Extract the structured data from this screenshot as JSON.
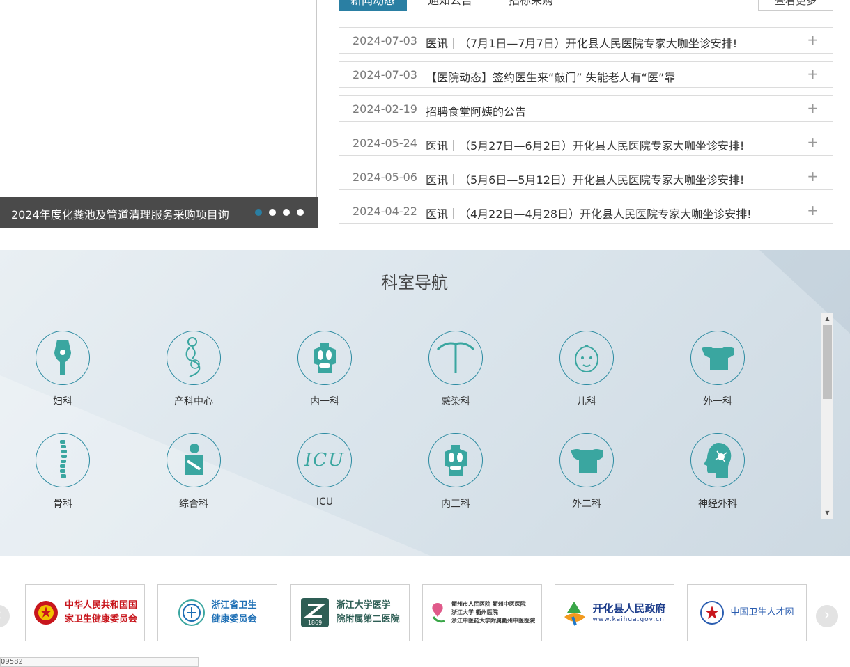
{
  "slider": {
    "caption": "2024年度化粪池及管道清理服务采购项目询",
    "dot_count": 4,
    "active_dot": 1
  },
  "news": {
    "tabs": [
      "新闻动态",
      "通知公告",
      "招标采购"
    ],
    "more": "查看更多",
    "items": [
      {
        "date": "2024-07-03",
        "title": "医讯｜（7月1日—7月7日）开化县人民医院专家大咖坐诊安排!"
      },
      {
        "date": "2024-07-03",
        "title": "【医院动态】签约医生来“敲门” 失能老人有“医”靠"
      },
      {
        "date": "2024-02-19",
        "title": "招聘食堂阿姨的公告"
      },
      {
        "date": "2024-05-24",
        "title": "医讯｜（5月27日—6月2日）开化县人民医院专家大咖坐诊安排!"
      },
      {
        "date": "2024-05-06",
        "title": "医讯｜（5月6日—5月12日）开化县人民医院专家大咖坐诊安排!"
      },
      {
        "date": "2024-04-22",
        "title": "医讯｜（4月22日—4月28日）开化县人民医院专家大咖坐诊安排!"
      }
    ],
    "plus": "+"
  },
  "dept": {
    "title": "科室导航",
    "items": [
      {
        "label": "妇科",
        "icon": "uterus-icon"
      },
      {
        "label": "产科中心",
        "icon": "pregnant-woman-icon"
      },
      {
        "label": "内一科",
        "icon": "torso-organs-icon"
      },
      {
        "label": "感染科",
        "icon": "iud-icon"
      },
      {
        "label": "儿科",
        "icon": "baby-face-icon"
      },
      {
        "label": "外一科",
        "icon": "torso-icon"
      },
      {
        "label": "骨科",
        "icon": "spine-icon"
      },
      {
        "label": "综合科",
        "icon": "patient-arm-sling-icon"
      },
      {
        "label": "ICU",
        "icon": "icu-text-icon",
        "icon_text": "ICU"
      },
      {
        "label": "内三科",
        "icon": "torso-organs-icon"
      },
      {
        "label": "外二科",
        "icon": "torso-icon"
      },
      {
        "label": "神经外科",
        "icon": "brain-head-icon"
      }
    ],
    "accent": "#2a8aa0",
    "icon_color": "#3aa6a0"
  },
  "links": [
    {
      "lines": [
        "中华人民共和国国",
        "家卫生健康委员会"
      ],
      "color": "#c8161d",
      "logo": "national-emblem-icon"
    },
    {
      "lines": [
        "浙江省卫生",
        "健康委员会"
      ],
      "color": "#1e6fb5",
      "logo": "zj-health-logo-icon"
    },
    {
      "lines": [
        "浙江大学医学",
        "院附属第二医院"
      ],
      "color": "#2e5e55",
      "logo": "zju-second-hospital-logo-icon",
      "badge": "1869"
    },
    {
      "lines": [
        "衢州市人民医院 衢州中医医院",
        "浙江大学 衢州医院",
        "浙江中医药大学附属衢州中医医院"
      ],
      "color": "#333333",
      "logo": "quzhou-hospital-logo-icon"
    },
    {
      "lines": [
        "开化县人民政府",
        "www.kaihua.gov.cn"
      ],
      "color": "#1f3f8c",
      "logo": "kaihua-gov-logo-icon"
    },
    {
      "lines": [
        "中国卫生人才网"
      ],
      "color": "#2a5db0",
      "logo": "health-talent-logo-icon"
    }
  ],
  "footer_fragment": "09582"
}
